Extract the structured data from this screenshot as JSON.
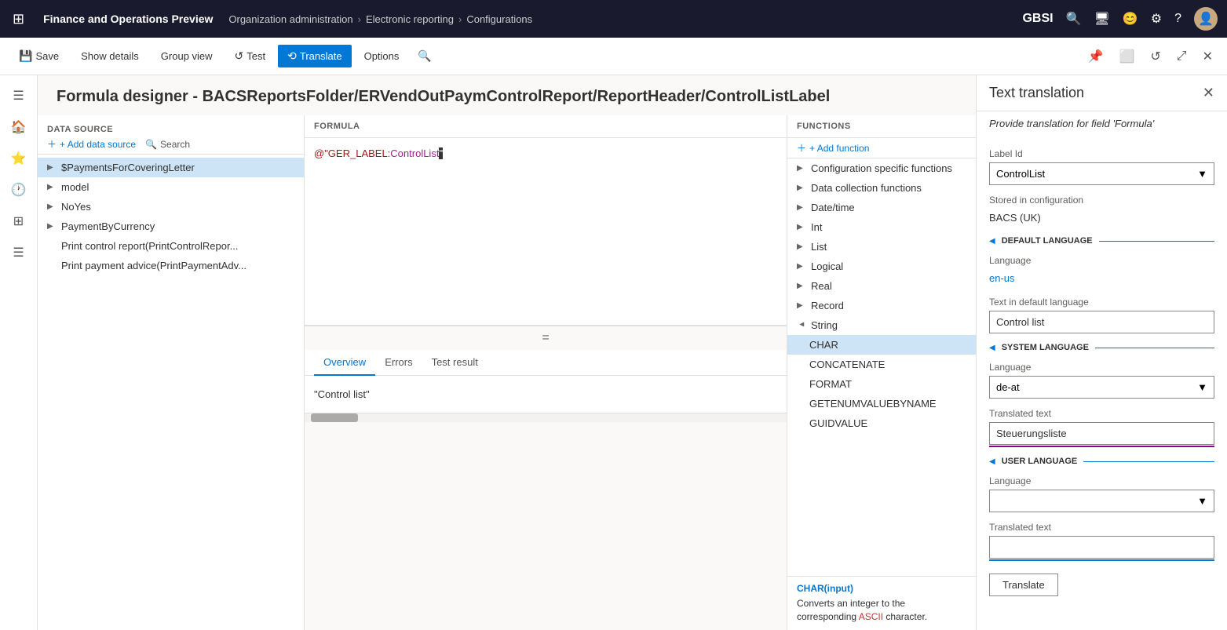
{
  "topbar": {
    "app_title": "Finance and Operations Preview",
    "breadcrumbs": [
      "Organization administration",
      "Electronic reporting",
      "Configurations"
    ],
    "org_badge": "GBSI"
  },
  "toolbar": {
    "save_label": "Save",
    "show_details_label": "Show details",
    "group_view_label": "Group view",
    "test_label": "Test",
    "translate_label": "Translate",
    "options_label": "Options"
  },
  "page": {
    "title": "Formula designer - BACSReportsFolder/ERVendOutPaymControlReport/ReportHeader/ControlListLabel"
  },
  "data_source": {
    "section_label": "DATA SOURCE",
    "add_label": "+ Add data source",
    "search_label": "Search",
    "items": [
      {
        "label": "$PaymentsForCoveringLetter",
        "level": 0,
        "expanded": false,
        "selected": true
      },
      {
        "label": "model",
        "level": 0,
        "expanded": false
      },
      {
        "label": "NoYes",
        "level": 0,
        "expanded": false
      },
      {
        "label": "PaymentByCurrency",
        "level": 0,
        "expanded": false
      },
      {
        "label": "Print control report(PrintControlRepor...",
        "level": 0,
        "leaf": true
      },
      {
        "label": "Print payment advice(PrintPaymentAdv...",
        "level": 0,
        "leaf": true
      }
    ]
  },
  "formula": {
    "section_label": "FORMULA",
    "content_prefix": "@\"GER_LABEL:",
    "content_label": "ControlList",
    "content_suffix": "\"",
    "tabs": [
      "Overview",
      "Errors",
      "Test result"
    ],
    "active_tab": "Overview",
    "result": "\"Control list\""
  },
  "functions": {
    "section_label": "FUNCTIONS",
    "add_label": "+ Add function",
    "items": [
      {
        "label": "Configuration specific functions",
        "level": 0,
        "expanded": false
      },
      {
        "label": "Data collection functions",
        "level": 0,
        "expanded": false
      },
      {
        "label": "Date/time",
        "level": 0,
        "expanded": false
      },
      {
        "label": "Int",
        "level": 0,
        "expanded": false
      },
      {
        "label": "List",
        "level": 0,
        "expanded": false
      },
      {
        "label": "Logical",
        "level": 0,
        "expanded": false
      },
      {
        "label": "Real",
        "level": 0,
        "expanded": false
      },
      {
        "label": "Record",
        "level": 0,
        "expanded": false
      },
      {
        "label": "String",
        "level": 0,
        "expanded": true
      },
      {
        "label": "CHAR",
        "level": 1,
        "selected": true
      },
      {
        "label": "CONCATENATE",
        "level": 1
      },
      {
        "label": "FORMAT",
        "level": 1
      },
      {
        "label": "GETENUMVALUEBYNAME",
        "level": 1
      },
      {
        "label": "GUIDVALUE",
        "level": 1,
        "partial": true
      }
    ],
    "description_title": "CHAR(input)",
    "description_text": "Converts an integer to the corresponding ASCII character."
  },
  "translation": {
    "panel_title": "Text translation",
    "subtitle_prefix": "Provide translation for field ",
    "subtitle_field": "'Formula'",
    "label_id_label": "Label Id",
    "label_id_value": "ControlList",
    "stored_in_label": "Stored in configuration",
    "stored_in_value": "BACS (UK)",
    "default_language_section": "DEFAULT LANGUAGE",
    "language_label": "Language",
    "default_lang_value": "en-us",
    "text_default_lang_label": "Text in default language",
    "text_default_lang_value": "Control list",
    "system_language_section": "SYSTEM LANGUAGE",
    "system_lang_value": "de-at",
    "translated_text_label": "Translated text",
    "translated_text_value": "Steuerungsliste",
    "user_language_section": "USER LANGUAGE",
    "user_lang_value": "",
    "user_translated_text_value": "",
    "translate_btn_label": "Translate"
  }
}
